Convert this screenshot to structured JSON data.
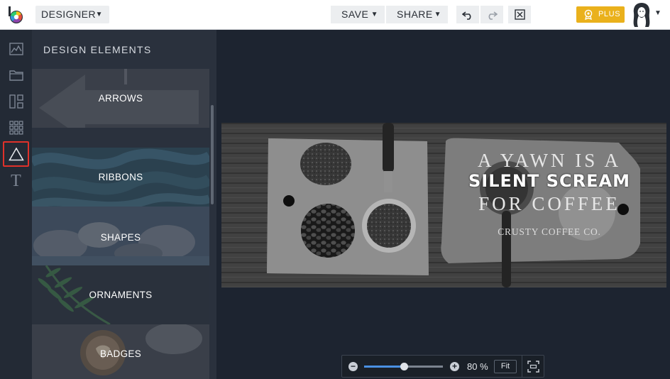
{
  "header": {
    "mode_label": "DESIGNER",
    "save_label": "SAVE",
    "share_label": "SHARE",
    "plus_label": "PLUS",
    "caret": "▼"
  },
  "rail": {
    "text_tool_glyph": "T",
    "icons": [
      "chart-icon",
      "folder-icon",
      "layout-icon",
      "grid-icon",
      "triangle-icon",
      "text-icon"
    ],
    "active": "triangle-icon"
  },
  "panel": {
    "title": "DESIGN ELEMENTS",
    "tiles": [
      {
        "label": "ARROWS"
      },
      {
        "label": "RIBBONS"
      },
      {
        "label": "SHAPES",
        "selected": true
      },
      {
        "label": "ORNAMENTS"
      },
      {
        "label": "BADGES"
      }
    ]
  },
  "design": {
    "line1": "A YAWN IS A",
    "line2": "SILENT SCREAM",
    "line3": "FOR COFFEE",
    "line4": "CRUSTY COFFEE CO."
  },
  "zoom": {
    "minus": "−",
    "plus": "+",
    "value_text": "80 %",
    "level_fraction": 0.5,
    "fit_label": "Fit"
  },
  "colors": {
    "accent_red": "#e0312a",
    "plus_gold": "#eab11c",
    "canvas_bg": "#1d2430",
    "slider_blue": "#4a90e2"
  }
}
